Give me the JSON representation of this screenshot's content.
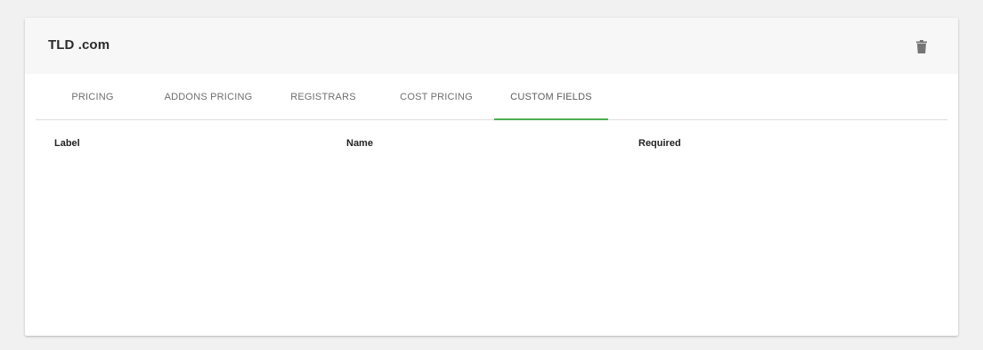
{
  "card": {
    "title": "TLD .com"
  },
  "tabs": [
    {
      "label": "PRICING",
      "active": false
    },
    {
      "label": "ADDONS PRICING",
      "active": false
    },
    {
      "label": "REGISTRARS",
      "active": false
    },
    {
      "label": "COST PRICING",
      "active": false
    },
    {
      "label": "CUSTOM FIELDS",
      "active": true
    }
  ],
  "table": {
    "columns": [
      "Label",
      "Name",
      "Required"
    ]
  },
  "icons": {
    "delete": "trash-icon"
  },
  "colors": {
    "accent": "#4caf50",
    "header_bg": "#f7f7f7",
    "page_bg": "#f1f1f1"
  }
}
